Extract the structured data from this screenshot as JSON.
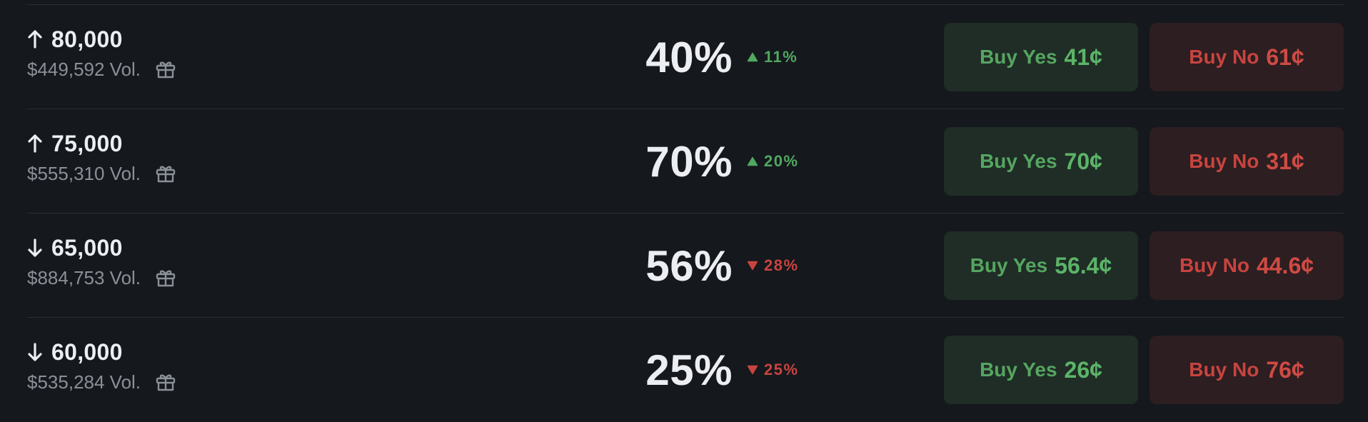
{
  "colors": {
    "background": "#15181d",
    "divider": "#2a2e35",
    "up": "#51a860",
    "down": "#c8443f",
    "yes_bg": "#1f2d26",
    "no_bg": "#2c1e21"
  },
  "rows": [
    {
      "direction": "up",
      "direction_icon": "arrow-up-icon",
      "title": "80,000",
      "volume": "$449,592 Vol.",
      "volume_icon": "gift-icon",
      "chance": "40%",
      "change": "11%",
      "change_direction": "up",
      "yes_label": "Buy Yes",
      "yes_price": "41¢",
      "no_label": "Buy No",
      "no_price": "61¢"
    },
    {
      "direction": "up",
      "direction_icon": "arrow-up-icon",
      "title": "75,000",
      "volume": "$555,310 Vol.",
      "volume_icon": "gift-icon",
      "chance": "70%",
      "change": "20%",
      "change_direction": "up",
      "yes_label": "Buy Yes",
      "yes_price": "70¢",
      "no_label": "Buy No",
      "no_price": "31¢"
    },
    {
      "direction": "down",
      "direction_icon": "arrow-down-icon",
      "title": "65,000",
      "volume": "$884,753 Vol.",
      "volume_icon": "gift-icon",
      "chance": "56%",
      "change": "28%",
      "change_direction": "down",
      "yes_label": "Buy Yes",
      "yes_price": "56.4¢",
      "no_label": "Buy No",
      "no_price": "44.6¢"
    },
    {
      "direction": "down",
      "direction_icon": "arrow-down-icon",
      "title": "60,000",
      "volume": "$535,284 Vol.",
      "volume_icon": "gift-icon",
      "chance": "25%",
      "change": "25%",
      "change_direction": "down",
      "yes_label": "Buy Yes",
      "yes_price": "26¢",
      "no_label": "Buy No",
      "no_price": "76¢"
    }
  ]
}
